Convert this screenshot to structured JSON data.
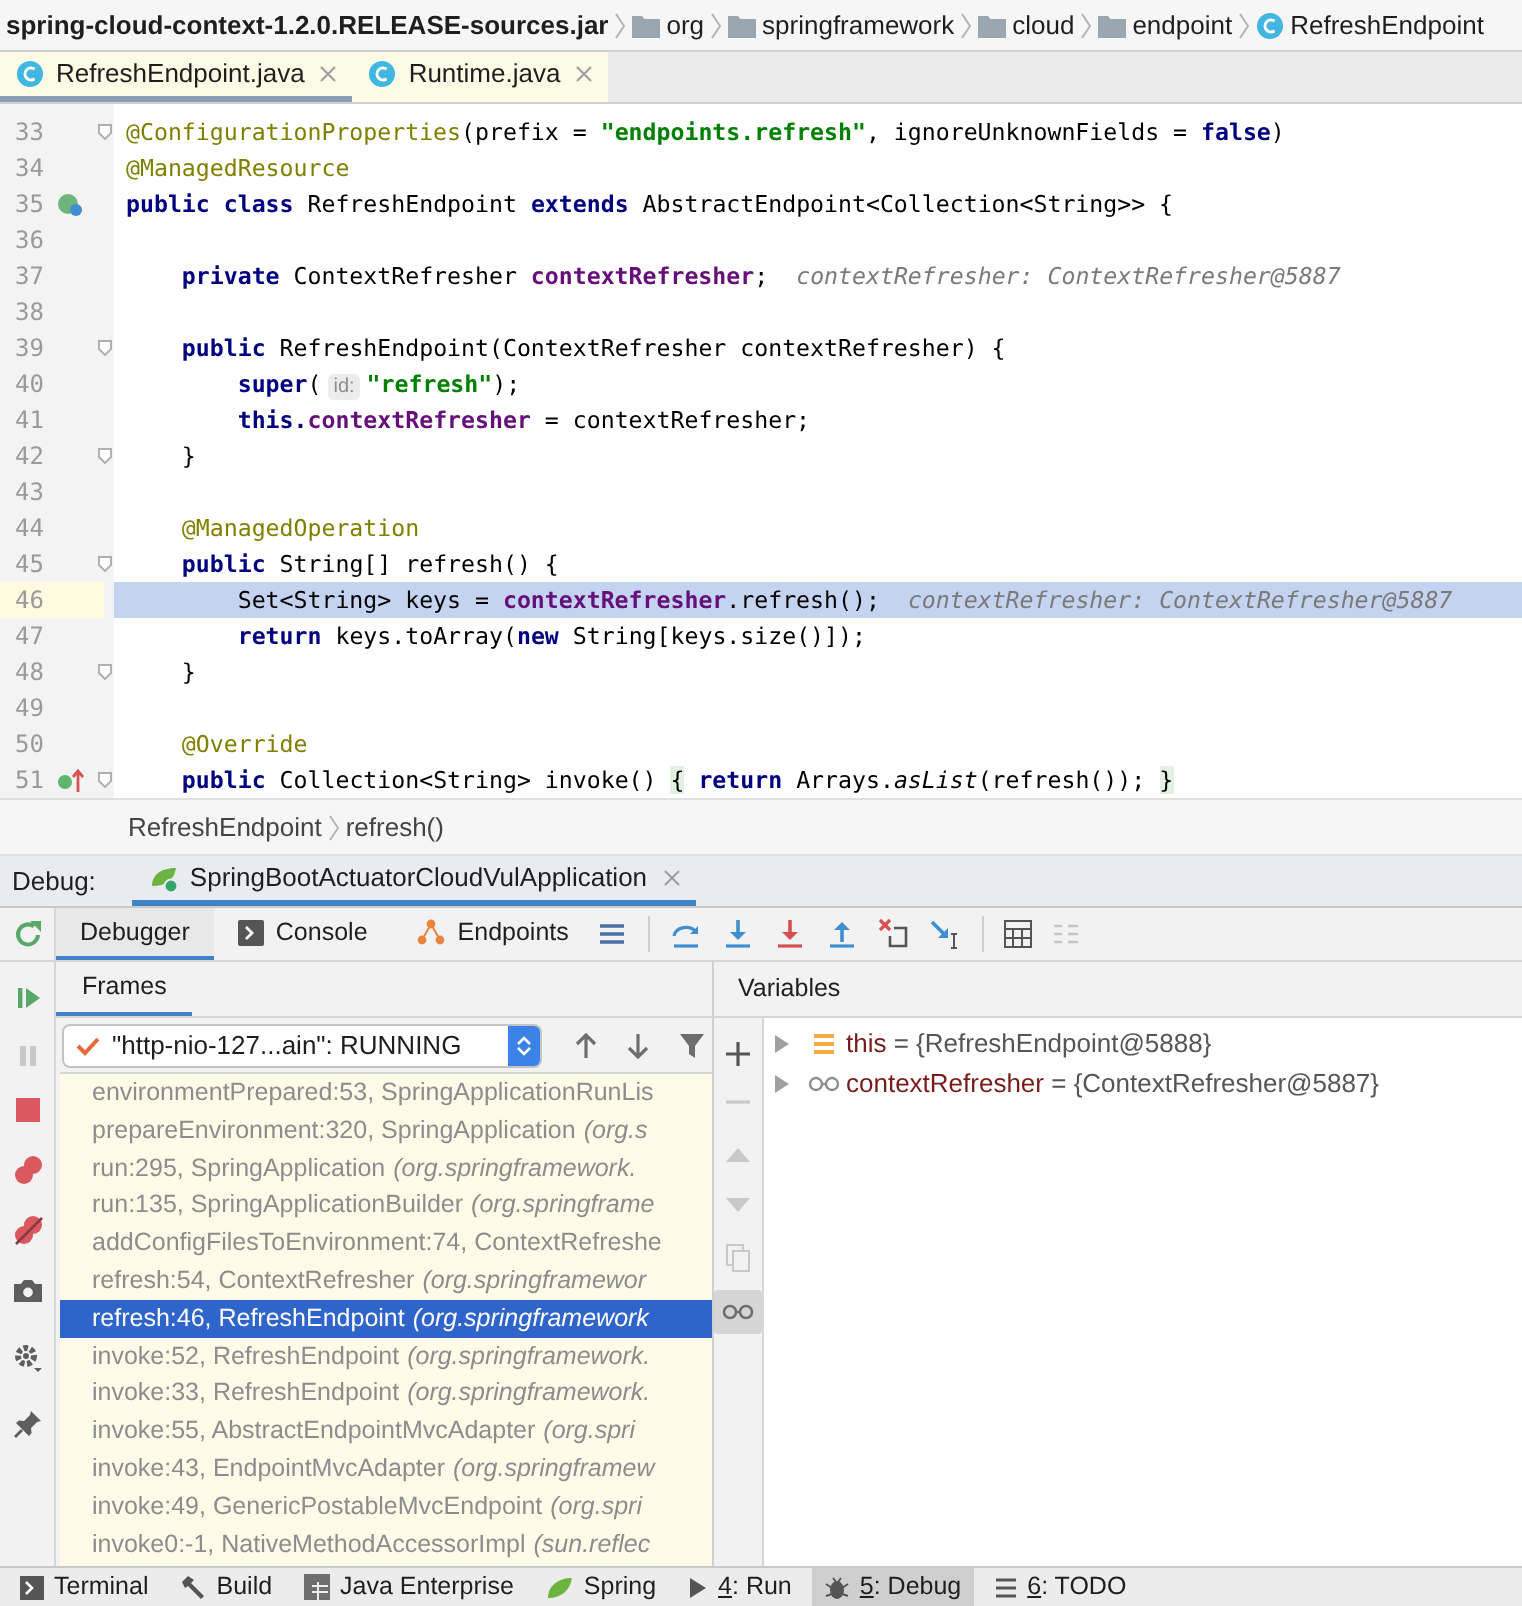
{
  "navigation_bar": {
    "items": [
      {
        "label": "spring-cloud-context-1.2.0.RELEASE-sources.jar",
        "kind": "archive"
      },
      {
        "label": "org",
        "kind": "folder"
      },
      {
        "label": "springframework",
        "kind": "folder"
      },
      {
        "label": "cloud",
        "kind": "folder"
      },
      {
        "label": "endpoint",
        "kind": "folder"
      },
      {
        "label": "RefreshEndpoint",
        "kind": "class"
      }
    ]
  },
  "editor_tabs": [
    {
      "label": "RefreshEndpoint.java",
      "selected": true
    },
    {
      "label": "Runtime.java",
      "selected": false
    }
  ],
  "editor": {
    "lines": [
      {
        "number": "33",
        "kind": "code",
        "fold": true,
        "tokens": [
          {
            "kind": "annotation",
            "text": "@ConfigurationProperties"
          },
          {
            "kind": "plain",
            "text": "(prefix = "
          },
          {
            "kind": "string",
            "text": "\"endpoints.refresh\""
          },
          {
            "kind": "plain",
            "text": ", ignoreUnknownFields = "
          },
          {
            "kind": "keyword",
            "text": "false"
          },
          {
            "kind": "plain",
            "text": ")"
          }
        ]
      },
      {
        "number": "34",
        "kind": "code",
        "tokens": [
          {
            "kind": "annotation",
            "text": "@ManagedResource"
          }
        ]
      },
      {
        "number": "35",
        "kind": "bean",
        "tokens": [
          {
            "kind": "keyword",
            "text": "public class"
          },
          {
            "kind": "plain",
            "text": " RefreshEndpoint "
          },
          {
            "kind": "keyword",
            "text": "extends"
          },
          {
            "kind": "plain",
            "text": " AbstractEndpoint<Collection<String>> {"
          }
        ]
      },
      {
        "number": "36",
        "kind": "code"
      },
      {
        "number": "37",
        "kind": "code",
        "tokens": [
          {
            "kind": "keyword",
            "text": "    private"
          },
          {
            "kind": "plain",
            "text": " ContextRefresher "
          },
          {
            "kind": "field",
            "text": "contextRefresher"
          },
          {
            "kind": "plain",
            "text": ";"
          }
        ],
        "inline_value": "contextRefresher: ContextRefresher@5887"
      },
      {
        "number": "38",
        "kind": "code"
      },
      {
        "number": "39",
        "kind": "code",
        "fold": true,
        "tokens": [
          {
            "kind": "keyword",
            "text": "    public"
          },
          {
            "kind": "plain",
            "text": " RefreshEndpoint(ContextRefresher contextRefresher) {"
          }
        ]
      },
      {
        "number": "40",
        "kind": "code",
        "tokens": [
          {
            "kind": "keyword",
            "text": "        super"
          },
          {
            "kind": "plain",
            "text": "("
          },
          {
            "kind": "parameter_hint",
            "text": "id:"
          },
          {
            "kind": "string",
            "text": "\"refresh\""
          },
          {
            "kind": "plain",
            "text": ");"
          }
        ]
      },
      {
        "number": "41",
        "kind": "code",
        "tokens": [
          {
            "kind": "keyword",
            "text": "        this."
          },
          {
            "kind": "field",
            "text": "contextRefresher"
          },
          {
            "kind": "plain",
            "text": " = contextRefresher;"
          }
        ]
      },
      {
        "number": "42",
        "kind": "code",
        "fold": true,
        "tokens": [
          {
            "kind": "plain",
            "text": "    }"
          }
        ]
      },
      {
        "number": "43",
        "kind": "code"
      },
      {
        "number": "44",
        "kind": "code",
        "tokens": [
          {
            "kind": "annotation",
            "text": "    @ManagedOperation"
          }
        ]
      },
      {
        "number": "45",
        "kind": "code",
        "fold": true,
        "tokens": [
          {
            "kind": "keyword",
            "text": "    public"
          },
          {
            "kind": "plain",
            "text": " String[] refresh() {"
          }
        ]
      },
      {
        "number": "46",
        "kind": "code",
        "current": true,
        "tokens": [
          {
            "kind": "plain",
            "text": "        Set<String> keys = "
          },
          {
            "kind": "field",
            "text": "contextRefresher"
          },
          {
            "kind": "plain",
            "text": ".refresh();"
          }
        ],
        "inline_value": "contextRefresher: ContextRefresher@5887"
      },
      {
        "number": "47",
        "kind": "code",
        "tokens": [
          {
            "kind": "keyword",
            "text": "        return"
          },
          {
            "kind": "plain",
            "text": " keys.toArray("
          },
          {
            "kind": "keyword",
            "text": "new"
          },
          {
            "kind": "plain",
            "text": " String[keys.size()]);"
          }
        ]
      },
      {
        "number": "48",
        "kind": "code",
        "fold": true,
        "tokens": [
          {
            "kind": "plain",
            "text": "    }"
          }
        ]
      },
      {
        "number": "49",
        "kind": "code"
      },
      {
        "number": "50",
        "kind": "code",
        "tokens": [
          {
            "kind": "annotation",
            "text": "    @Override"
          }
        ]
      },
      {
        "number": "51",
        "kind": "override",
        "fold": true,
        "tokens": [
          {
            "kind": "keyword",
            "text": "    public"
          },
          {
            "kind": "plain",
            "text": " Collection<String> invoke() "
          },
          {
            "kind": "folded",
            "text": "{"
          },
          {
            "kind": "keyword",
            "text": " return"
          },
          {
            "kind": "plain",
            "text": " Arrays."
          },
          {
            "kind": "italic",
            "text": "asList"
          },
          {
            "kind": "plain",
            "text": "(refresh()); "
          },
          {
            "kind": "folded",
            "text": "}"
          }
        ]
      }
    ]
  },
  "editor_breadcrumb": [
    "RefreshEndpoint",
    "refresh()"
  ],
  "debug_window": {
    "label": "Debug:",
    "session_tabs": [
      {
        "label": "SpringBootActuatorCloudVulApplication",
        "selected": true
      }
    ],
    "tabs": [
      {
        "label": "Debugger",
        "selected": true
      },
      {
        "label": "Console",
        "selected": false
      },
      {
        "label": "Endpoints",
        "selected": false
      }
    ],
    "frames_panel": {
      "title": "Frames",
      "thread": "\"http-nio-127...ain\": RUNNING",
      "frames": [
        {
          "text": "environmentPrepared:53, SpringApplicationRunLis",
          "selected": false
        },
        {
          "text": "prepareEnvironment:320, SpringApplication",
          "package": "(org.s",
          "selected": false
        },
        {
          "text": "run:295, SpringApplication",
          "package": "(org.springframework.",
          "selected": false
        },
        {
          "text": "run:135, SpringApplicationBuilder",
          "package": "(org.springframe",
          "selected": false
        },
        {
          "text": "addConfigFilesToEnvironment:74, ContextRefreshe",
          "selected": false
        },
        {
          "text": "refresh:54, ContextRefresher",
          "package": "(org.springframewor",
          "selected": false
        },
        {
          "text": "refresh:46, RefreshEndpoint",
          "package": "(org.springframework",
          "selected": true
        },
        {
          "text": "invoke:52, RefreshEndpoint",
          "package": "(org.springframework.",
          "selected": false
        },
        {
          "text": "invoke:33, RefreshEndpoint",
          "package": "(org.springframework.",
          "selected": false
        },
        {
          "text": "invoke:55, AbstractEndpointMvcAdapter",
          "package": "(org.spri",
          "selected": false
        },
        {
          "text": "invoke:43, EndpointMvcAdapter",
          "package": "(org.springframew",
          "selected": false
        },
        {
          "text": "invoke:49, GenericPostableMvcEndpoint",
          "package": "(org.spri",
          "selected": false
        },
        {
          "text": "invoke0:-1, NativeMethodAccessorImpl",
          "package": "(sun.reflec",
          "selected": false
        }
      ]
    },
    "variables_panel": {
      "title": "Variables",
      "variables": [
        {
          "name": "this",
          "value": "= {RefreshEndpoint@5888}",
          "kind": "field"
        },
        {
          "name": "contextRefresher",
          "value": "= {ContextRefresher@5887}",
          "kind": "watch"
        }
      ]
    }
  },
  "tool_window_bar": [
    {
      "label": "Terminal",
      "selected": false
    },
    {
      "label": "Build",
      "selected": false
    },
    {
      "label": "Java Enterprise",
      "selected": false
    },
    {
      "label": "Spring",
      "selected": false
    },
    {
      "mnemonic": "4",
      "label": ": Run",
      "selected": false
    },
    {
      "mnemonic": "5",
      "label": ": Debug",
      "selected": true
    },
    {
      "mnemonic": "6",
      "label": ": TODO",
      "selected": false
    }
  ]
}
